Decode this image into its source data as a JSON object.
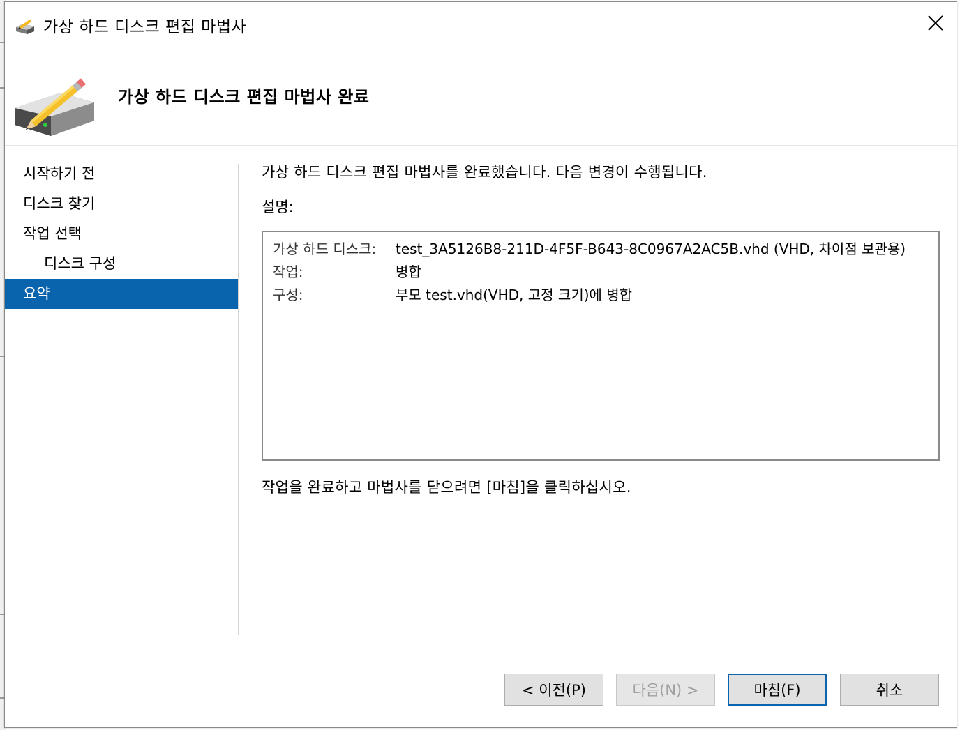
{
  "window": {
    "title": "가상 하드 디스크 편집 마법사",
    "close_label": "×"
  },
  "header": {
    "title": "가상 하드 디스크 편집 마법사 완료"
  },
  "nav": {
    "items": [
      {
        "label": "시작하기 전"
      },
      {
        "label": "디스크 찾기"
      },
      {
        "label": "작업 선택"
      },
      {
        "label": "디스크 구성"
      },
      {
        "label": "요약"
      }
    ]
  },
  "main": {
    "intro": "가상 하드 디스크 편집 마법사를 완료했습니다. 다음 변경이 수행됩니다.",
    "description_label": "설명:",
    "summary": [
      {
        "key": "가상 하드 디스크:",
        "value": "test_3A5126B8-211D-4F5F-B643-8C0967A2AC5B.vhd (VHD, 차이점 보관용)"
      },
      {
        "key": "작업:",
        "value": "병합"
      },
      {
        "key": "구성:",
        "value": "부모 test.vhd(VHD, 고정 크기)에 병합"
      }
    ],
    "outro": "작업을 완료하고 마법사를 닫으려면 [마침]을 클릭하십시오."
  },
  "buttons": {
    "previous": "< 이전(P)",
    "next": "다음(N) >",
    "finish": "마침(F)",
    "cancel": "취소"
  },
  "colors": {
    "selection": "#0a64ad"
  }
}
